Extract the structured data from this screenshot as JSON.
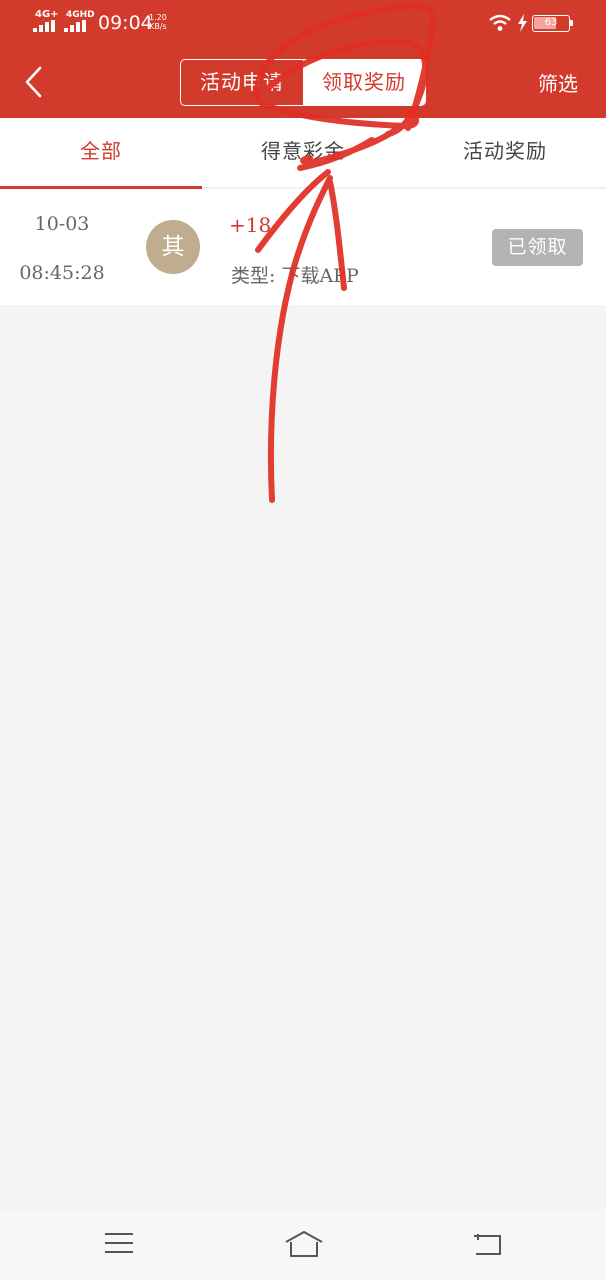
{
  "status_bar": {
    "signal1_label": "4G+",
    "signal2_label": "4GHD",
    "time": "09:04",
    "speed_value": "1.20",
    "speed_unit": "KB/s",
    "battery": "63"
  },
  "header": {
    "segments": [
      "活动申请",
      "领取奖励"
    ],
    "active_segment": "领取奖励",
    "filter_label": "筛选"
  },
  "tabs": [
    {
      "label": "全部",
      "active": true
    },
    {
      "label": "得意彩金",
      "active": false
    },
    {
      "label": "活动奖励",
      "active": false
    }
  ],
  "records": [
    {
      "date": "10-03",
      "time": "08:45:28",
      "avatar_char": "其",
      "amount": "+18",
      "type": "类型: 下载APP",
      "status": "已领取"
    }
  ],
  "colors": {
    "brand_red": "#d23a2b",
    "avatar_tan": "#c0ad8f",
    "claimed_gray": "#b3b3b3"
  },
  "icons": [
    "back-arrow-icon",
    "wifi-icon",
    "charging-bolt-icon",
    "battery-icon",
    "menu-icon",
    "home-icon",
    "return-icon"
  ]
}
